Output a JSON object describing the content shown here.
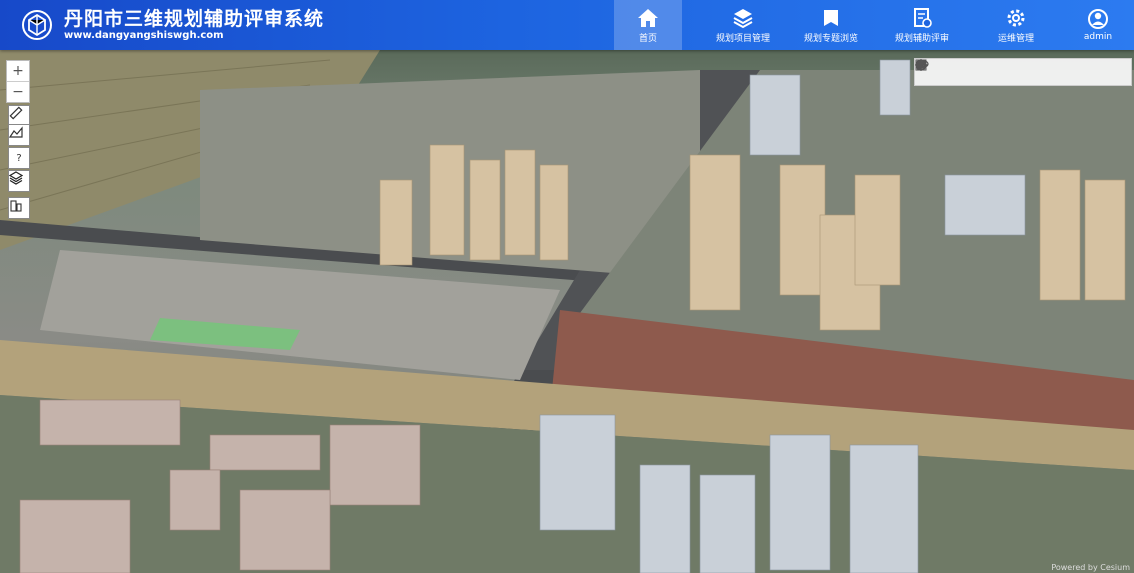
{
  "app": {
    "title": "丹阳市三维规划辅助评审系统",
    "url": "www.dangyangshiswgh.com"
  },
  "nav": {
    "items": [
      {
        "label": "首页",
        "icon": "home-icon",
        "active": true
      },
      {
        "label": "规划项目管理",
        "icon": "layers-icon",
        "active": false
      },
      {
        "label": "规划专题浏览",
        "icon": "book-icon",
        "active": false
      },
      {
        "label": "规划辅助评审",
        "icon": "review-document-icon",
        "active": false
      },
      {
        "label": "运维管理",
        "icon": "gear-icon",
        "active": false
      },
      {
        "label": "admin",
        "icon": "user-icon",
        "active": false
      }
    ]
  },
  "map": {
    "zoom_in": "+",
    "zoom_out": "−",
    "help": "?",
    "powered": "Powered by Cesium"
  },
  "colors": {
    "header_start": "#1749c9",
    "header_end": "#2c7bf0",
    "river": "#b3a27b",
    "road": "#4a4c4f"
  }
}
